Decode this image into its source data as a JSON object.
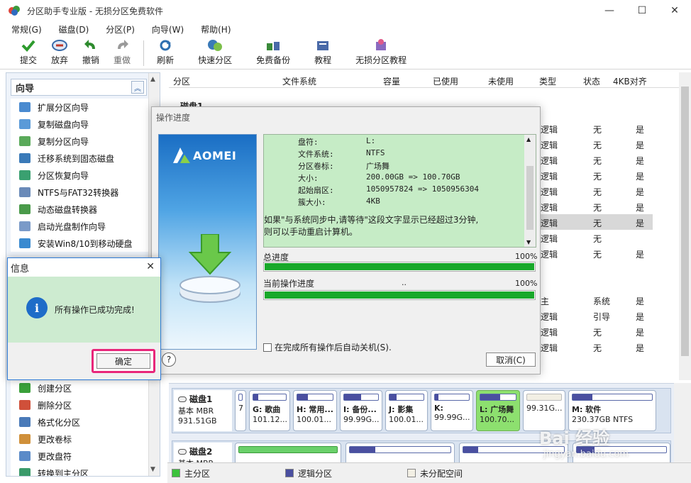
{
  "window": {
    "title": "分区助手专业版 - 无损分区免费软件",
    "min": "—",
    "max": "☐",
    "close": "✕"
  },
  "menu": [
    "常规(G)",
    "磁盘(D)",
    "分区(P)",
    "向导(W)",
    "帮助(H)"
  ],
  "toolbar": {
    "items": [
      {
        "label": "提交",
        "icon": "check-icon",
        "color": "#2e9b2e"
      },
      {
        "label": "放弃",
        "icon": "discard-icon",
        "color": "#c0392b"
      },
      {
        "label": "撤销",
        "icon": "undo-icon",
        "color": "#2e8b2e"
      },
      {
        "label": "重做",
        "icon": "redo-icon",
        "color": "#888888"
      },
      {
        "label": "刷新",
        "icon": "refresh-icon",
        "color": "#2e6fb0"
      },
      {
        "label": "快速分区",
        "icon": "quick-partition-icon",
        "color": "#3a7ab8"
      },
      {
        "label": "免费备份",
        "icon": "backup-icon",
        "color": "#3a8a3a"
      },
      {
        "label": "教程",
        "icon": "tutorial-icon",
        "color": "#4a6aa8"
      },
      {
        "label": "无损分区教程",
        "icon": "lossless-tutorial-icon",
        "color": "#c04a8a"
      }
    ]
  },
  "left_panel": {
    "title": "向导",
    "wizard_items": [
      "扩展分区向导",
      "复制磁盘向导",
      "复制分区向导",
      "迁移系统到固态磁盘",
      "分区恢复向导",
      "NTFS与FAT32转换器",
      "动态磁盘转换器",
      "启动光盘制作向导",
      "安装Win8/10到移动硬盘"
    ],
    "partition_items": [
      "创建分区",
      "删除分区",
      "格式化分区",
      "更改卷标",
      "更改盘符",
      "转换到主分区"
    ]
  },
  "table": {
    "headers": [
      "分区",
      "文件系统",
      "容量",
      "已使用",
      "未使用",
      "类型",
      "状态",
      "4KB对齐"
    ],
    "disk1_label": "磁盘1",
    "rows": [
      {
        "type": "逻辑",
        "status": "无",
        "align": "是"
      },
      {
        "type": "逻辑",
        "status": "无",
        "align": "是"
      },
      {
        "type": "逻辑",
        "status": "无",
        "align": "是"
      },
      {
        "type": "逻辑",
        "status": "无",
        "align": "是"
      },
      {
        "type": "逻辑",
        "status": "无",
        "align": "是"
      },
      {
        "type": "逻辑",
        "status": "无",
        "align": "是"
      },
      {
        "type": "逻辑",
        "status": "无",
        "align": "是",
        "selected": true
      },
      {
        "type": "逻辑",
        "status": "无",
        "align": ""
      },
      {
        "type": "逻辑",
        "status": "无",
        "align": "是"
      },
      {
        "type": "",
        "status": "",
        "align": ""
      },
      {
        "type": "",
        "status": "",
        "align": ""
      },
      {
        "type": "主",
        "status": "系统",
        "align": "是"
      },
      {
        "type": "逻辑",
        "status": "引导",
        "align": "是"
      },
      {
        "type": "逻辑",
        "status": "无",
        "align": "是"
      },
      {
        "type": "逻辑",
        "status": "无",
        "align": "是"
      }
    ]
  },
  "op_dialog": {
    "title": "操作进度",
    "brand": "AOMEI",
    "info": [
      {
        "k": "盘符:",
        "v": "L:"
      },
      {
        "k": "文件系统:",
        "v": "NTFS"
      },
      {
        "k": "分区卷标:",
        "v": "广场舞"
      },
      {
        "k": "大小:",
        "v": "200.00GB => 100.70GB"
      },
      {
        "k": "起始扇区:",
        "v": "1050957824 => 1050956304"
      },
      {
        "k": "簇大小:",
        "v": "4KB"
      }
    ],
    "note_line1": "如果\"与系统同步中,请等待\"这段文字显示已经超过3分钟,",
    "note_line2": "则可以手动重启计算机。",
    "total_label": "总进度",
    "total_pct": "100%",
    "total_value": 1.0,
    "current_label": "当前操作进度",
    "current_mid": "..",
    "current_pct": "100%",
    "current_value": 1.0,
    "shutdown_label": "在完成所有操作后自动关机(S).",
    "cancel_label": "取消(C)",
    "help": "?"
  },
  "info_dialog": {
    "title": "信息",
    "message": "所有操作已成功完成!",
    "ok_label": "确定",
    "close": "✕",
    "icon_glyph": "i"
  },
  "disk_map": {
    "disk1": {
      "name": "磁盘1",
      "type": "基本 MBR",
      "size": "931.51GB",
      "partitions": [
        {
          "name": "",
          "size": "7",
          "used": 0.0
        },
        {
          "name": "G: 歌曲",
          "size": "101.12...",
          "used": 0.15
        },
        {
          "name": "H: 常用...",
          "size": "100.01...",
          "used": 0.3
        },
        {
          "name": "I: 备份...",
          "size": "99.99G...",
          "used": 0.5
        },
        {
          "name": "J: 影集",
          "size": "100.01...",
          "used": 0.2
        },
        {
          "name": "K:",
          "size": "99.99G...",
          "used": 0.1
        },
        {
          "name": "L: 广场舞",
          "size": "100.70...",
          "used": 0.55,
          "active": true
        },
        {
          "name": "",
          "size": "99.31G...",
          "used": 0.0
        },
        {
          "name": "M: 软件",
          "size": "230.37GB NTFS",
          "used": 0.25
        }
      ]
    },
    "disk2": {
      "name": "磁盘2",
      "type": "基本 MBR"
    }
  },
  "legend": [
    {
      "label": "主分区",
      "color": "#3cc23c"
    },
    {
      "label": "逻辑分区",
      "color": "#4a4fa0"
    },
    {
      "label": "未分配空间",
      "color": "#f2efe4"
    }
  ],
  "watermark": {
    "brand": "Bai 经验",
    "url": "jingyan.baidu.com"
  }
}
